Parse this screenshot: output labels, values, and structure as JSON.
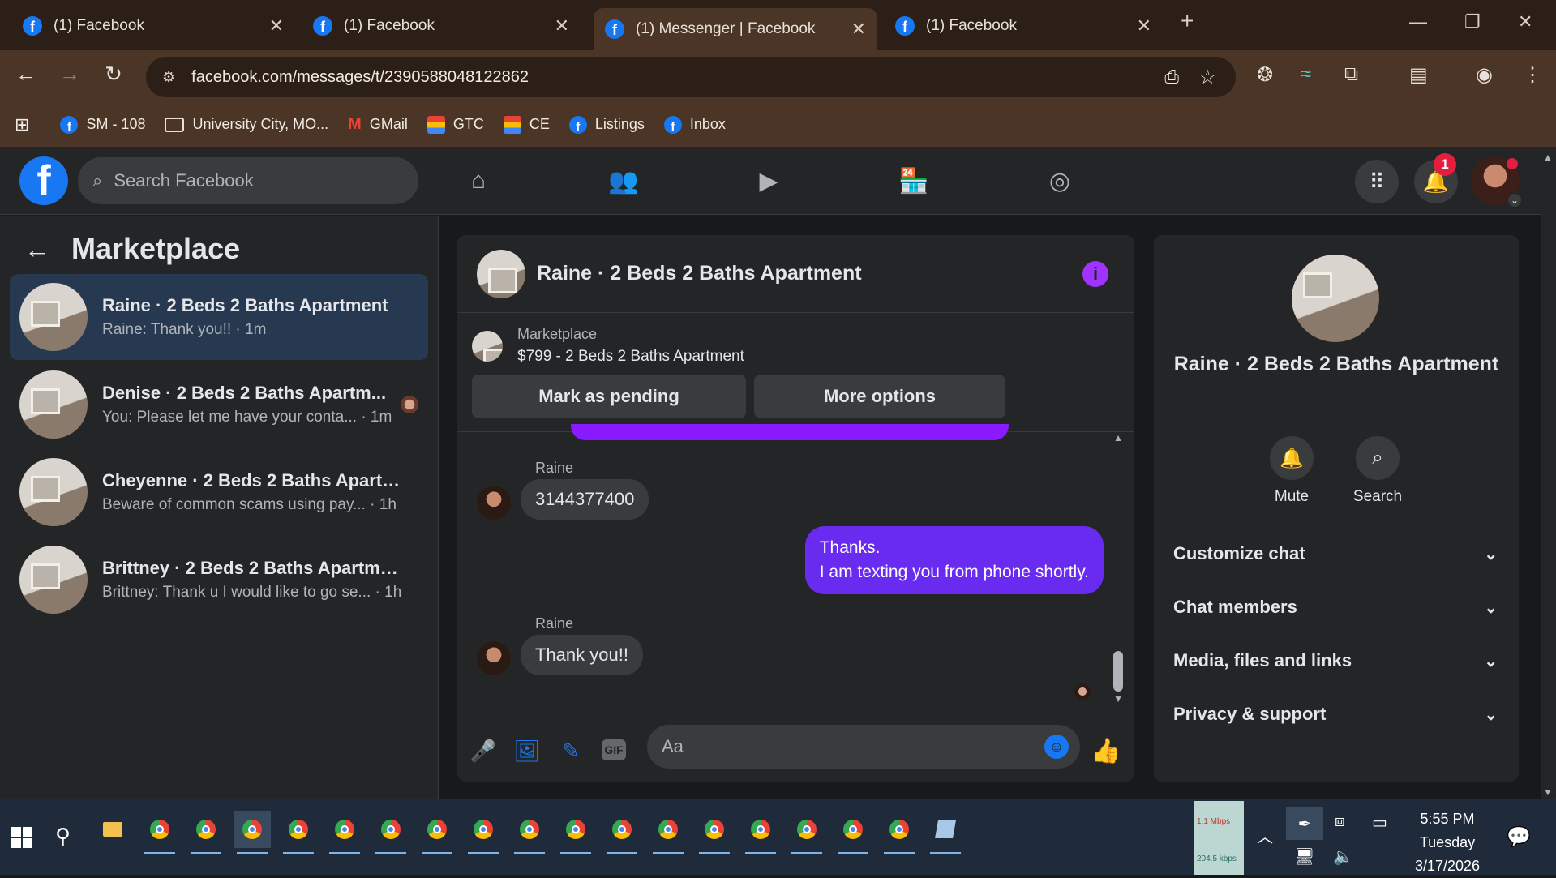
{
  "browser": {
    "tabs": [
      {
        "title": "(1) Facebook",
        "active": false
      },
      {
        "title": "(1) Facebook",
        "active": false
      },
      {
        "title": "(1) Messenger | Facebook",
        "active": true
      },
      {
        "title": "(1) Facebook",
        "active": false
      }
    ],
    "new_tab": "+",
    "url": "facebook.com/messages/t/2390588048122862",
    "bookmarks": [
      {
        "label": "SM - 108",
        "icon": "facebook-icon"
      },
      {
        "label": "University City, MO...",
        "icon": "folder-icon"
      },
      {
        "label": "GMail",
        "icon": "gmail-icon"
      },
      {
        "label": "GTC",
        "icon": "bookmark-icon"
      },
      {
        "label": "CE",
        "icon": "bookmark-icon"
      },
      {
        "label": "Listings",
        "icon": "facebook-icon"
      },
      {
        "label": "Inbox",
        "icon": "facebook-icon"
      }
    ]
  },
  "fb": {
    "search_placeholder": "Search Facebook",
    "notification_count": "1"
  },
  "left": {
    "title": "Marketplace",
    "conversations": [
      {
        "name": "Raine · 2 Beds 2 Baths Apartment",
        "preview": "Raine: Thank you!! · 1m",
        "active": true
      },
      {
        "name": "Denise · 2 Beds 2 Baths Apartm...",
        "preview": "You: Please let me have your conta... · 1m",
        "active": false
      },
      {
        "name": "Cheyenne · 2 Beds 2 Baths Apartm...",
        "preview": "Beware of common scams using pay... · 1h",
        "active": false
      },
      {
        "name": "Brittney · 2 Beds 2 Baths Apartment",
        "preview": "Brittney: Thank u I would like to go se... · 1h",
        "active": false
      }
    ]
  },
  "chat": {
    "title": "Raine · 2 Beds 2 Baths Apartment",
    "listing_source": "Marketplace",
    "listing_title": "$799 - 2 Beds 2 Baths Apartment",
    "mark_pending": "Mark as pending",
    "more_options": "More options",
    "messages": [
      {
        "sender": "Raine",
        "text": "3144377400",
        "direction": "in"
      },
      {
        "text_line1": "Thanks.",
        "text_line2": "I am texting you from phone shortly.",
        "direction": "out"
      },
      {
        "sender": "Raine",
        "text": "Thank you!!",
        "direction": "in"
      }
    ],
    "input_placeholder": "Aa"
  },
  "right": {
    "title": "Raine · 2 Beds 2 Baths Apartment",
    "mute": "Mute",
    "search": "Search",
    "sections": [
      "Customize chat",
      "Chat members",
      "Media, files and links",
      "Privacy & support"
    ]
  },
  "taskbar": {
    "net_down": "1.1 Mbps",
    "net_up": "204.5 kbps",
    "time": "5:55 PM",
    "day": "Tuesday",
    "date": "3/17/2026"
  },
  "colors": {
    "fb_blue": "#1877f2",
    "outgoing_bubble": "#6a2bf0",
    "active_conversation": "#263951"
  }
}
